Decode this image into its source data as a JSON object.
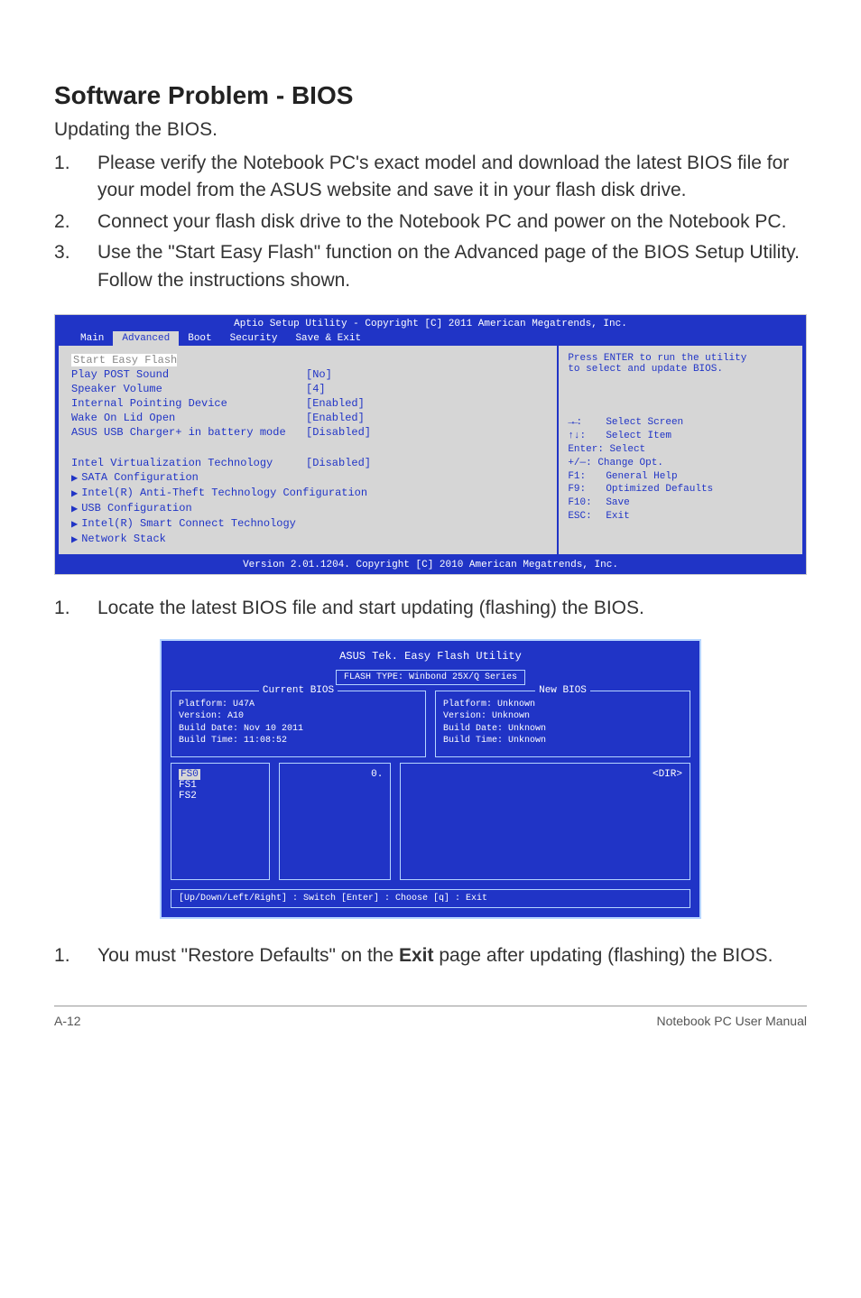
{
  "heading": "Software Problem - BIOS",
  "subtitle": "Updating the BIOS.",
  "steps": {
    "s1": "Please verify the Notebook PC's exact model and download the latest BIOS file for your model from the ASUS website and save it in your flash disk drive.",
    "s2": "Connect your flash disk drive to the Notebook PC and power on the Notebook PC.",
    "s3": "Use the \"Start Easy Flash\" function on the Advanced page of the BIOS Setup Utility. Follow the instructions shown.",
    "s4": "Locate the latest BIOS file and start updating (flashing) the BIOS.",
    "s5a": "You must \"Restore Defaults\" on the ",
    "s5b": "Exit",
    "s5c": " page after updating (flashing) the BIOS."
  },
  "bios1": {
    "title": "Aptio Setup Utility - Copyright [C] 2011 American Megatrends, Inc.",
    "tabs": {
      "main": "Main",
      "advanced": "Advanced",
      "boot": "Boot",
      "security": "Security",
      "save": "Save & Exit"
    },
    "rows": {
      "start": "Start Easy Flash",
      "post_sound": {
        "label": "Play POST Sound",
        "value": "[No]"
      },
      "speaker": {
        "label": "Speaker Volume",
        "value": "[4]"
      },
      "pointing": {
        "label": "Internal Pointing Device",
        "value": "[Enabled]"
      },
      "lid": {
        "label": "Wake On Lid Open",
        "value": "[Enabled]"
      },
      "usb_charger": {
        "label": "ASUS USB Charger+ in battery mode",
        "value": "[Disabled]"
      },
      "virt": {
        "label": "Intel Virtualization Technology",
        "value": "[Disabled]"
      },
      "sata": "SATA Configuration",
      "anti_theft": "Intel(R) Anti-Theft Technology Configuration",
      "usb_conf": "USB Configuration",
      "smart_connect": "Intel(R) Smart Connect Technology",
      "network": "Network Stack"
    },
    "right": {
      "hint1": "Press ENTER to run the utility",
      "hint2": "to select and update BIOS.",
      "help": {
        "select_screen": "Select Screen",
        "select_item": "Select Item",
        "enter": "Enter: Select",
        "change": "+/—:  Change Opt.",
        "f1": {
          "k": "F1:",
          "t": "General Help"
        },
        "f9": {
          "k": "F9:",
          "t": "Optimized Defaults"
        },
        "f10": {
          "k": "F10:",
          "t": "Save"
        },
        "esc": {
          "k": "ESC:",
          "t": "Exit"
        }
      }
    },
    "footer": "Version 2.01.1204. Copyright [C] 2010 American Megatrends, Inc."
  },
  "bios2": {
    "title": "ASUS Tek. Easy Flash Utility",
    "subtitle": "FLASH TYPE: Winbond 25X/Q Series",
    "current": {
      "label": "Current BIOS",
      "platform": "Platform:   U47A",
      "version": "Version:    A10",
      "build_date": "Build Date: Nov 10 2011",
      "build_time": "Build Time: 11:08:52"
    },
    "new": {
      "label": "New BIOS",
      "platform": "Platform:   Unknown",
      "version": "Version:    Unknown",
      "build_date": "Build Date: Unknown",
      "build_time": "Build Time: Unknown"
    },
    "fs": {
      "fs0": "FS0",
      "fs1": "FS1",
      "fs2": "FS2"
    },
    "col2": "0.",
    "col3": "<DIR>",
    "footer": "[Up/Down/Left/Right] : Switch   [Enter] : Choose   [q] : Exit"
  },
  "page_footer": {
    "left": "A-12",
    "right": "Notebook PC User Manual"
  }
}
